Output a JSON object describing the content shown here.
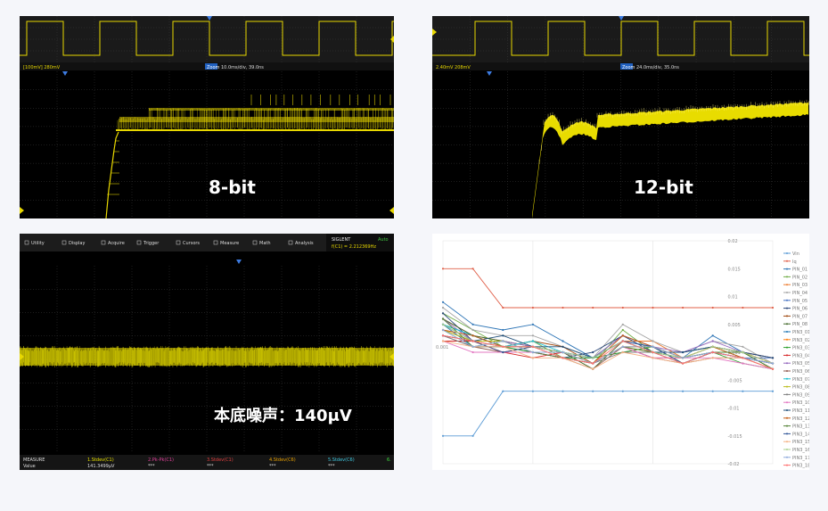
{
  "panels": {
    "p8bit": {
      "label": "8-bit",
      "info_left": "[100mV] 280mV",
      "info_mid": "Zoom",
      "info_right": "10.0ms/div, 39.0ns"
    },
    "p12bit": {
      "label": "12-bit",
      "info_left": "2.40mV 208mV",
      "info_mid": "Zoom",
      "info_right": "24.0ms/div, 35.0ns"
    },
    "noise": {
      "label": "本底噪声：140μV",
      "menu": [
        "Utility",
        "Display",
        "Acquire",
        "Trigger",
        "Cursors",
        "Measure",
        "Math",
        "Analysis"
      ],
      "menu_icons": [
        "gear-icon",
        "display-icon",
        "acquire-icon",
        "trigger-flag-icon",
        "cursors-icon",
        "measure-icon",
        "math-icon",
        "analysis-icon"
      ],
      "brand": "SIGLENT",
      "brand_mode": "Auto",
      "brand_sub": "f(C1) = 2.212369Hz",
      "measure_title": "MEASURE",
      "value_label": "Value",
      "measure_cols": [
        "1.Stdev(C1)",
        "2.Pk-Pk(C1)",
        "3.Stdev(C1)",
        "4.Stdev(C6)",
        "5.Stdev(C6)",
        "6."
      ],
      "measure_vals": [
        "141.3499μV",
        "***",
        "***",
        "***",
        "***",
        ""
      ],
      "measure_colors": [
        "#e8e000",
        "#e0409a",
        "#e04040",
        "#e8a000",
        "#40c8e0",
        "#40e040"
      ]
    }
  },
  "chart_data": {
    "type": "line",
    "x": [
      1,
      2,
      3,
      4,
      5,
      6,
      7,
      8,
      9,
      10,
      11,
      12
    ],
    "yticks": [
      "0.02",
      "0.015",
      "0.01",
      "0.005",
      "0.001",
      "-0.005",
      "-0.01",
      "-0.015",
      "-0.02"
    ],
    "y_label_value": "0.001",
    "ylim": [
      -0.02,
      0.02
    ],
    "grid": "vertical",
    "legend_position": "right",
    "series": [
      {
        "name": "Vin",
        "color": "#5b9bd5",
        "values": [
          -0.015,
          -0.015,
          -0.007,
          -0.007,
          -0.007,
          -0.007,
          -0.007,
          -0.007,
          -0.007,
          -0.007,
          -0.007,
          -0.007
        ]
      },
      {
        "name": "Iq",
        "color": "#e0604a",
        "values": [
          0.015,
          0.015,
          0.008,
          0.008,
          0.008,
          0.008,
          0.008,
          0.008,
          0.008,
          0.008,
          0.008,
          0.008
        ]
      },
      {
        "name": "PIN_01",
        "color": "#2e75b6",
        "values": [
          0.009,
          0.005,
          0.004,
          0.005,
          0.002,
          -0.001,
          0.003,
          0.001,
          -0.001,
          0.003,
          0.0,
          -0.002
        ]
      },
      {
        "name": "PIN_02",
        "color": "#70ad47",
        "values": [
          0.007,
          0.004,
          0.001,
          0.002,
          -0.001,
          -0.002,
          0.004,
          0.0,
          0.0,
          0.001,
          -0.001,
          -0.003
        ]
      },
      {
        "name": "PIN_03",
        "color": "#ed7d31",
        "values": [
          0.006,
          0.003,
          0.002,
          0.001,
          0.0,
          -0.001,
          0.002,
          0.002,
          -0.001,
          0.0,
          0.0,
          -0.002
        ]
      },
      {
        "name": "PIN_04",
        "color": "#a5a5a5",
        "values": [
          0.008,
          0.004,
          0.003,
          0.003,
          0.001,
          -0.001,
          0.005,
          0.002,
          0.0,
          0.002,
          0.001,
          -0.002
        ]
      },
      {
        "name": "PIN_05",
        "color": "#4472c4",
        "values": [
          0.005,
          0.003,
          0.001,
          0.001,
          0.0,
          -0.001,
          0.002,
          0.001,
          -0.001,
          0.0,
          -0.001,
          -0.001
        ]
      },
      {
        "name": "PIN_06",
        "color": "#264478",
        "values": [
          0.007,
          0.002,
          0.002,
          0.0,
          -0.001,
          0.0,
          0.003,
          0.0,
          0.0,
          0.001,
          0.0,
          -0.001
        ]
      },
      {
        "name": "PIN_07",
        "color": "#9e480e",
        "values": [
          0.004,
          0.002,
          0.001,
          0.002,
          0.001,
          -0.002,
          0.001,
          0.001,
          -0.002,
          0.0,
          0.0,
          -0.002
        ]
      },
      {
        "name": "PIN_08",
        "color": "#43682b",
        "values": [
          0.006,
          0.003,
          0.002,
          0.001,
          0.0,
          -0.003,
          0.002,
          0.0,
          -0.001,
          0.001,
          0.0,
          -0.003
        ]
      },
      {
        "name": "PIN3_01",
        "color": "#1f77b4",
        "values": [
          0.005,
          0.001,
          0.001,
          0.0,
          -0.001,
          -0.001,
          0.002,
          0.0,
          -0.002,
          0.0,
          -0.001,
          -0.002
        ]
      },
      {
        "name": "PIN3_02",
        "color": "#ff7f0e",
        "values": [
          0.003,
          0.002,
          0.0,
          0.001,
          0.0,
          -0.002,
          0.001,
          0.0,
          -0.001,
          0.001,
          0.0,
          -0.001
        ]
      },
      {
        "name": "PIN3_03",
        "color": "#2ca02c",
        "values": [
          0.004,
          0.001,
          0.001,
          0.0,
          -0.001,
          -0.001,
          0.0,
          0.001,
          -0.002,
          0.0,
          -0.002,
          -0.003
        ]
      },
      {
        "name": "PIN3_04",
        "color": "#d62728",
        "values": [
          0.002,
          0.002,
          0.0,
          -0.001,
          0.0,
          -0.002,
          0.001,
          -0.001,
          -0.001,
          0.0,
          0.0,
          -0.002
        ]
      },
      {
        "name": "PIN3_05",
        "color": "#9467bd",
        "values": [
          0.006,
          0.002,
          0.002,
          0.001,
          0.0,
          -0.001,
          0.003,
          0.001,
          0.0,
          0.002,
          0.0,
          -0.001
        ]
      },
      {
        "name": "PIN3_06",
        "color": "#8c564b",
        "values": [
          0.003,
          0.001,
          0.0,
          0.0,
          -0.001,
          -0.003,
          0.001,
          -0.001,
          -0.002,
          -0.001,
          -0.001,
          -0.003
        ]
      },
      {
        "name": "PIN3_07",
        "color": "#17becf",
        "values": [
          0.005,
          0.003,
          0.001,
          0.002,
          0.0,
          -0.001,
          0.002,
          0.0,
          -0.001,
          0.0,
          -0.001,
          -0.002
        ]
      },
      {
        "name": "PIN3_08",
        "color": "#bcbd22",
        "values": [
          0.004,
          0.002,
          0.002,
          0.0,
          0.0,
          -0.002,
          0.001,
          0.001,
          -0.001,
          0.001,
          0.0,
          -0.002
        ]
      },
      {
        "name": "PIN3_09",
        "color": "#7f7f7f",
        "values": [
          0.003,
          0.001,
          0.001,
          0.001,
          -0.001,
          -0.002,
          0.0,
          0.0,
          -0.002,
          0.0,
          -0.001,
          -0.002
        ]
      },
      {
        "name": "PIN3_10",
        "color": "#e377c2",
        "values": [
          0.002,
          0.0,
          0.0,
          0.0,
          -0.001,
          -0.002,
          0.001,
          -0.001,
          -0.001,
          -0.001,
          -0.002,
          -0.003
        ]
      },
      {
        "name": "PIN3_11",
        "color": "#1f4e79",
        "values": [
          0.005,
          0.002,
          0.003,
          0.001,
          0.001,
          -0.001,
          0.002,
          0.0,
          0.0,
          0.001,
          0.0,
          -0.001
        ]
      },
      {
        "name": "PIN3_12",
        "color": "#c55a11",
        "values": [
          0.004,
          0.003,
          0.001,
          0.001,
          0.0,
          -0.002,
          0.003,
          0.001,
          -0.001,
          0.001,
          -0.001,
          -0.002
        ]
      },
      {
        "name": "PIN3_13",
        "color": "#548235",
        "values": [
          0.006,
          0.001,
          0.002,
          0.0,
          -0.001,
          -0.002,
          0.001,
          0.0,
          -0.001,
          0.0,
          0.0,
          -0.003
        ]
      },
      {
        "name": "PIN3_14",
        "color": "#2f5597",
        "values": [
          0.003,
          0.002,
          0.0,
          0.001,
          0.0,
          -0.001,
          0.002,
          0.001,
          -0.002,
          0.0,
          -0.001,
          -0.002
        ]
      },
      {
        "name": "PIN3_15",
        "color": "#f4b183",
        "values": [
          0.002,
          0.001,
          0.001,
          -0.001,
          -0.001,
          -0.003,
          0.0,
          -0.001,
          -0.002,
          -0.001,
          -0.001,
          -0.003
        ]
      },
      {
        "name": "PIN3_16",
        "color": "#a9d18e",
        "values": [
          0.005,
          0.002,
          0.001,
          0.001,
          0.0,
          -0.001,
          0.002,
          0.0,
          -0.001,
          0.001,
          0.0,
          -0.002
        ]
      },
      {
        "name": "PIN3_17",
        "color": "#8faadc",
        "values": [
          0.004,
          0.001,
          0.002,
          0.0,
          0.0,
          -0.002,
          0.001,
          0.001,
          -0.001,
          0.0,
          -0.001,
          -0.002
        ]
      },
      {
        "name": "PIN3_18",
        "color": "#ff6f6f",
        "values": [
          0.003,
          0.002,
          0.001,
          0.001,
          -0.001,
          -0.002,
          0.002,
          0.0,
          -0.002,
          0.0,
          -0.001,
          -0.003
        ]
      }
    ]
  }
}
